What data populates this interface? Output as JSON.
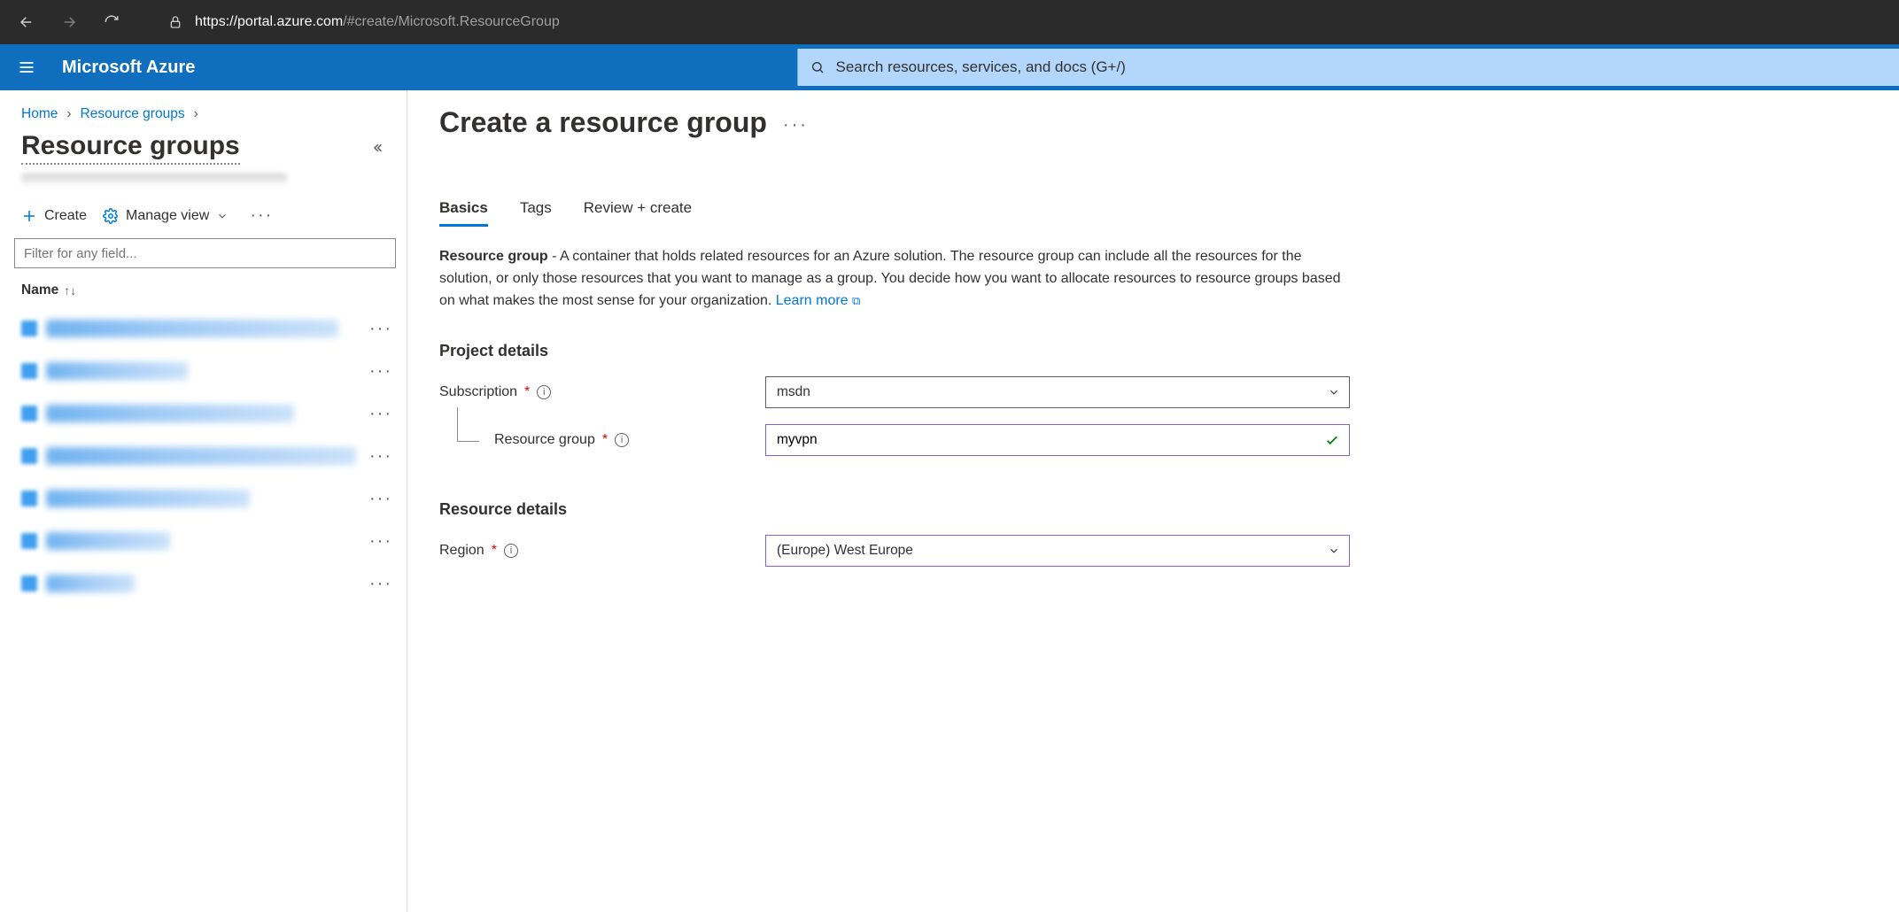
{
  "browser": {
    "url_host": "https://portal.azure.com",
    "url_path": "/#create/Microsoft.ResourceGroup"
  },
  "header": {
    "brand": "Microsoft Azure",
    "search_placeholder": "Search resources, services, and docs (G+/)"
  },
  "breadcrumb": {
    "items": [
      "Home",
      "Resource groups"
    ]
  },
  "left_panel": {
    "title": "Resource groups",
    "create_label": "Create",
    "manage_view_label": "Manage view",
    "filter_placeholder": "Filter for any field...",
    "column_name": "Name",
    "row_count": 7
  },
  "main": {
    "title": "Create a resource group",
    "tabs": [
      "Basics",
      "Tags",
      "Review + create"
    ],
    "active_tab_index": 0,
    "description_lead": "Resource group",
    "description_body": " - A container that holds related resources for an Azure solution. The resource group can include all the resources for the solution, or only those resources that you want to manage as a group. You decide how you want to allocate resources to resource groups based on what makes the most sense for your organization. ",
    "learn_more": "Learn more",
    "section_project": "Project details",
    "subscription_label": "Subscription",
    "subscription_value": "msdn",
    "resource_group_label": "Resource group",
    "resource_group_value": "myvpn",
    "section_resource": "Resource details",
    "region_label": "Region",
    "region_value": "(Europe) West Europe"
  }
}
